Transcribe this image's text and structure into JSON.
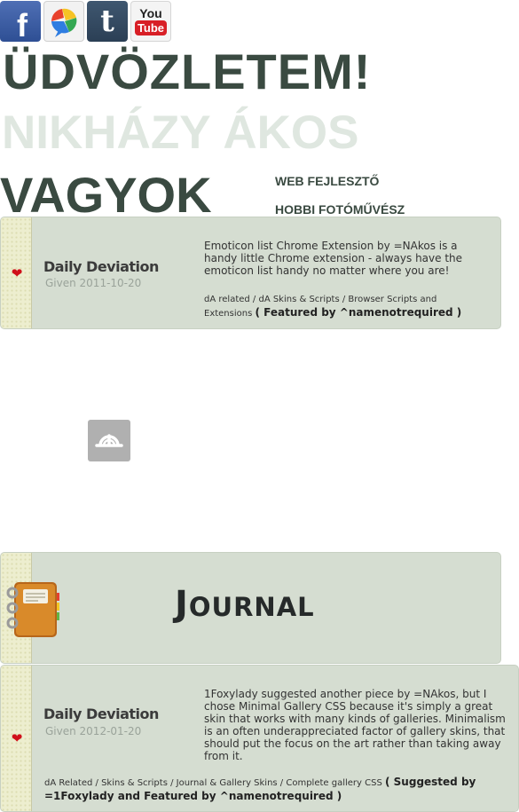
{
  "social": {
    "facebook": "f",
    "buzz": "buzz-icon",
    "tumblr": "t",
    "youtube_you": "You",
    "youtube_tube": "Tube"
  },
  "header": {
    "greeting": "ÜDVÖZLETEM!",
    "name": "NIKHÁZY ÁKOS",
    "verb": "VAGYOK",
    "role1": "WEB FEJLESZTŐ",
    "role2": "HOBBI FOTÓMŰVÉSZ"
  },
  "dd1": {
    "title": "Daily Deviation",
    "given": "Given 2011-10-20",
    "desc": "Emoticon list Chrome Extension by =NAkos is a handy little Chrome extension - always have the emoticon list handy no matter where you are!",
    "categories": "dA related / dA Skins & Scripts / Browser Scripts and Extensions",
    "featured": "( Featured by ^namenotrequired )"
  },
  "deviantart_button": "deviantart-icon",
  "journal": {
    "title_first": "J",
    "title_rest": "OURNAL"
  },
  "dd2": {
    "title": "Daily Deviation",
    "given": "Given 2012-01-20",
    "desc": "1Foxylady suggested another piece by =NAkos, but I chose Minimal Gallery CSS because it's simply a great skin that works with many kinds of galleries. Minimalism is an often underappreciated factor of gallery skins, that should put the focus on the art rather than taking away from it.",
    "categories": "dA Related / Skins & Scripts / Journal & Gallery Skins / Complete gallery CSS",
    "featured": "( Suggested by =1Foxylady and Featured by ^namenotrequired )"
  },
  "colors": {
    "heading": "#3a4a41",
    "name_faded": "#dfe7e0",
    "card_bg": "#d5ddd1",
    "heart": "#d0101a"
  }
}
